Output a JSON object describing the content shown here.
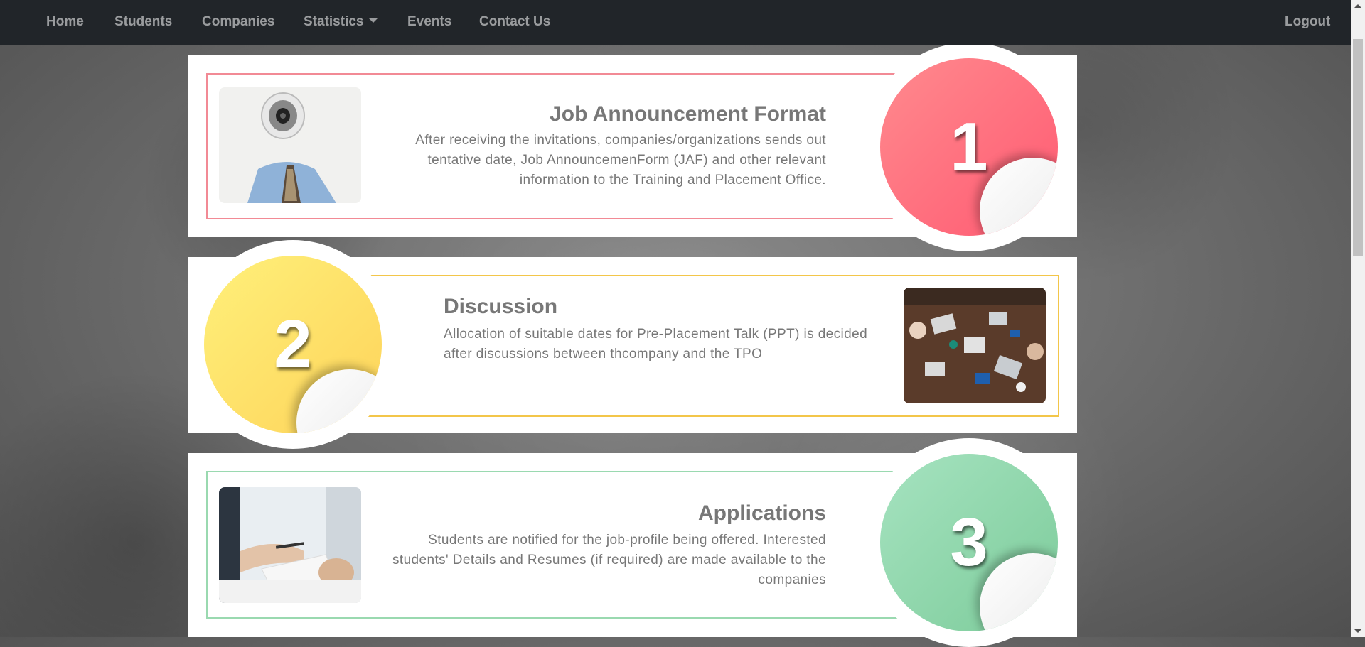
{
  "nav": {
    "items": [
      "Home",
      "Students",
      "Companies",
      "Statistics",
      "Events",
      "Contact Us"
    ],
    "logout": "Logout"
  },
  "steps": [
    {
      "number": "1",
      "title": "Job Announcement Format",
      "description": "After receiving the invitations, companies/organizations sends out tentative date, Job AnnouncemenForm (JAF) and other relevant information to the Training and Placement Office.",
      "image": "megaphone-photo",
      "color": "#ff5a6e"
    },
    {
      "number": "2",
      "title": "Discussion",
      "description": "Allocation of suitable dates for Pre-Placement Talk (PPT) is decided after discussions between thcompany and the TPO",
      "image": "meeting-table-photo",
      "color": "#fdd85a"
    },
    {
      "number": "3",
      "title": "Applications",
      "description": "Students are notified for the job-profile being offered. Interested students' Details and Resumes (if required) are made available to the companies",
      "image": "handshake-document-photo",
      "color": "#8fd8a8"
    }
  ]
}
